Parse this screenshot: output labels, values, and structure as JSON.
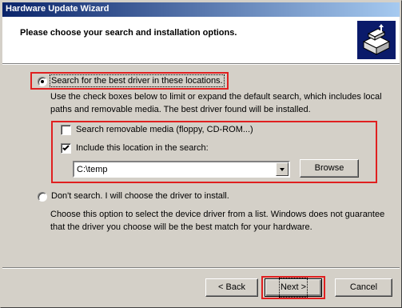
{
  "window": {
    "title": "Hardware Update Wizard"
  },
  "header": {
    "heading": "Please choose your search and installation options.",
    "icon": "hardware-wizard-icon"
  },
  "options": {
    "search_radio": {
      "label": "Search for the best driver in these locations.",
      "selected": true
    },
    "search_description": "Use the check boxes below to limit or expand the default search, which includes local paths and removable media. The best driver found will be installed.",
    "removable_media": {
      "label": "Search removable media (floppy, CD-ROM...)",
      "checked": false
    },
    "include_location": {
      "label": "Include this location in the search:",
      "checked": true
    },
    "location_value": "C:\\temp",
    "browse_label": "Browse",
    "dont_search_radio": {
      "label": "Don't search. I will choose the driver to install.",
      "selected": false
    },
    "dont_search_description": "Choose this option to select the device driver from a list.  Windows does not guarantee that the driver you choose will be the best match for your hardware."
  },
  "footer": {
    "back_label": "< Back",
    "next_label": "Next >",
    "cancel_label": "Cancel"
  },
  "colors": {
    "title_gradient_start": "#0a246a",
    "title_gradient_end": "#a6caf0",
    "highlight": "#e02020",
    "face": "#d4d0c8"
  }
}
